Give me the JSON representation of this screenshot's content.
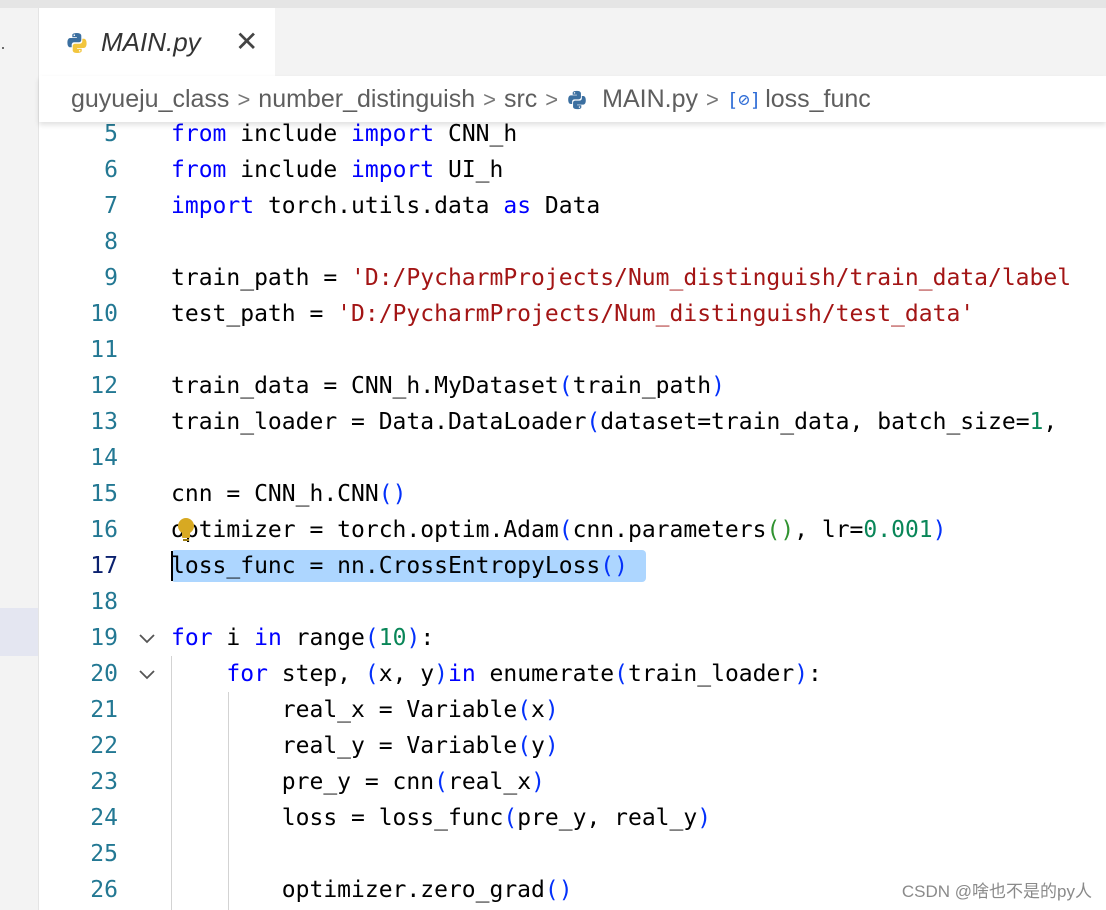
{
  "tab": {
    "label": "MAIN.py",
    "close_glyph": "✕",
    "icon": "python-file-icon"
  },
  "breadcrumb": {
    "items": [
      "guyueju_class",
      "number_distinguish",
      "src",
      "MAIN.py",
      "loss_func"
    ],
    "separator": ">",
    "symbol_glyph": "[⊘]"
  },
  "editor": {
    "active_line": 17,
    "lines": [
      {
        "n": "5",
        "tokens": [
          [
            "kw",
            "from"
          ],
          [
            "",
            "include "
          ],
          [
            "kw",
            "import"
          ],
          [
            "",
            "CNN_h"
          ]
        ]
      },
      {
        "n": "6",
        "tokens": [
          [
            "kw",
            "from"
          ],
          [
            "",
            "include "
          ],
          [
            "kw",
            "import"
          ],
          [
            "",
            "UI_h"
          ]
        ]
      },
      {
        "n": "7",
        "tokens": [
          [
            "kw",
            "import"
          ],
          [
            "",
            "torch.utils.data "
          ],
          [
            "kw",
            "as"
          ],
          [
            "",
            "Data"
          ]
        ]
      },
      {
        "n": "8",
        "tokens": []
      },
      {
        "n": "9",
        "tokens": [
          [
            "",
            "train_path = "
          ],
          [
            "str",
            "'D:/PycharmProjects/Num_distinguish/train_data/label"
          ]
        ]
      },
      {
        "n": "10",
        "tokens": [
          [
            "",
            "test_path = "
          ],
          [
            "str",
            "'D:/PycharmProjects/Num_distinguish/test_data'"
          ]
        ]
      },
      {
        "n": "11",
        "tokens": []
      },
      {
        "n": "12",
        "tokens": [
          [
            "",
            "train_data = CNN_h.MyDataset"
          ],
          [
            "p1",
            "("
          ],
          [
            "",
            "train_path"
          ],
          [
            "p1",
            ")"
          ]
        ]
      },
      {
        "n": "13",
        "tokens": [
          [
            "",
            "train_loader = Data.DataLoader"
          ],
          [
            "p1",
            "("
          ],
          [
            "",
            "dataset=train_data, batch_size="
          ],
          [
            "num",
            "1"
          ],
          [
            "",
            ","
          ]
        ]
      },
      {
        "n": "14",
        "tokens": []
      },
      {
        "n": "15",
        "tokens": [
          [
            "",
            "cnn = CNN_h.CNN"
          ],
          [
            "p1",
            "()"
          ]
        ]
      },
      {
        "n": "16",
        "tokens": [
          [
            "",
            "optimizer = torch.optim.Adam"
          ],
          [
            "p1",
            "("
          ],
          [
            "",
            "cnn.parameters"
          ],
          [
            "p2",
            "()"
          ],
          [
            "",
            ", lr="
          ],
          [
            "num",
            "0.001"
          ],
          [
            "p1",
            ")"
          ]
        ]
      },
      {
        "n": "17",
        "tokens": [
          [
            "",
            "loss_func = nn.CrossEntropyLoss"
          ],
          [
            "p1",
            "()"
          ]
        ]
      },
      {
        "n": "18",
        "tokens": []
      },
      {
        "n": "19",
        "tokens": [
          [
            "kw",
            "for"
          ],
          [
            "",
            "i "
          ],
          [
            "kw",
            "in"
          ],
          [
            "",
            "range"
          ],
          [
            "p1",
            "("
          ],
          [
            "num",
            "10"
          ],
          [
            "p1",
            ")"
          ],
          [
            "",
            ":"
          ]
        ]
      },
      {
        "n": "20",
        "tokens": [
          [
            "",
            "    "
          ],
          [
            "kw",
            "for"
          ],
          [
            "",
            "step, "
          ],
          [
            "p1",
            "("
          ],
          [
            "",
            "x, y"
          ],
          [
            "p1",
            ")"
          ],
          [
            "",
            ""
          ],
          [
            "kw",
            "in"
          ],
          [
            "",
            "enumerate"
          ],
          [
            "p1",
            "("
          ],
          [
            "",
            "train_loader"
          ],
          [
            "p1",
            ")"
          ],
          [
            "",
            ":"
          ]
        ]
      },
      {
        "n": "21",
        "tokens": [
          [
            "",
            "        real_x = Variable"
          ],
          [
            "p1",
            "("
          ],
          [
            "",
            "x"
          ],
          [
            "p1",
            ")"
          ]
        ]
      },
      {
        "n": "22",
        "tokens": [
          [
            "",
            "        real_y = Variable"
          ],
          [
            "p1",
            "("
          ],
          [
            "",
            "y"
          ],
          [
            "p1",
            ")"
          ]
        ]
      },
      {
        "n": "23",
        "tokens": [
          [
            "",
            "        pre_y = cnn"
          ],
          [
            "p1",
            "("
          ],
          [
            "",
            "real_x"
          ],
          [
            "p1",
            ")"
          ]
        ]
      },
      {
        "n": "24",
        "tokens": [
          [
            "",
            "        loss = loss_func"
          ],
          [
            "p1",
            "("
          ],
          [
            "",
            "pre_y, real_y"
          ],
          [
            "p1",
            ")"
          ]
        ]
      },
      {
        "n": "25",
        "tokens": []
      },
      {
        "n": "26",
        "tokens": [
          [
            "",
            "        optimizer.zero_grad"
          ],
          [
            "p1",
            "()"
          ]
        ]
      }
    ]
  },
  "watermark": "CSDN @啥也不是的py人",
  "colors": {
    "keyword": "#0000ff",
    "string": "#a31515",
    "number": "#098658",
    "bracket_level1": "#0431fa",
    "bracket_level2": "#319331",
    "selection": "#add6ff",
    "line_number": "#237893",
    "lightbulb": "#d7a922"
  }
}
